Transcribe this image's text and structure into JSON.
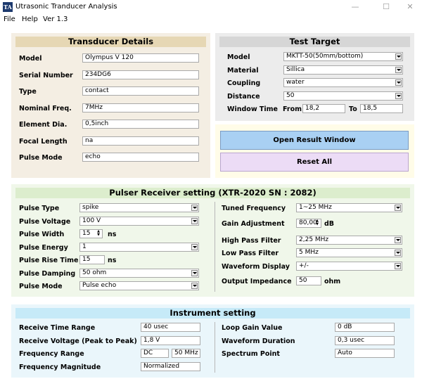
{
  "window": {
    "icon_text": "TA",
    "title": "Utrasonic Tranducer Analysis",
    "min": "—",
    "max": "☐",
    "close": "✕"
  },
  "menu": [
    "File",
    "Help",
    "Ver 1.3"
  ],
  "transducer": {
    "header": "Transducer Details",
    "rows": [
      {
        "label": "Model",
        "value": "Olympus V 120"
      },
      {
        "label": "Serial Number",
        "value": "234DG6"
      },
      {
        "label": "Type",
        "value": "contact"
      },
      {
        "label": "Nominal Freq.",
        "value": "7MHz"
      },
      {
        "label": "Element Dia.",
        "value": "0,5inch"
      },
      {
        "label": "Focal Length",
        "value": "na"
      },
      {
        "label": "Pulse Mode",
        "value": "echo"
      }
    ]
  },
  "target": {
    "header": "Test Target",
    "rows": [
      {
        "label": "Model",
        "value": "MKTT-50(50mm/bottom)"
      },
      {
        "label": "Material",
        "value": "Sillica"
      },
      {
        "label": "Coupling",
        "value": "water"
      },
      {
        "label": "Distance",
        "value": "50"
      }
    ],
    "window_time": {
      "label": "Window Time",
      "from_label": "From",
      "from": "18,2",
      "to_label": "To",
      "to": "18,5"
    }
  },
  "actions": {
    "open_result": "Open Result Window",
    "reset_all": "Reset All"
  },
  "pulser": {
    "header": "Pulser Receiver setting (XTR-2020  SN : 2082)",
    "left": [
      {
        "label": "Pulse Type",
        "value": "spike"
      },
      {
        "label": "Pulse Voltage",
        "value": "100 V"
      },
      {
        "label": "Pulse Width",
        "value": "15",
        "unit": "ns"
      },
      {
        "label": "Pulse Energy",
        "value": "1"
      },
      {
        "label": "Pulse Rise Time",
        "value": "15",
        "unit": "ns"
      },
      {
        "label": "Pulse Damping",
        "value": "50 ohm"
      },
      {
        "label": "Pulse Mode",
        "value": "Pulse echo"
      }
    ],
    "right": [
      {
        "label": "Tuned Frequency",
        "value": "1~25 MHz"
      },
      {
        "label": "Gain Adjustment",
        "value": "80,00",
        "unit": "dB"
      },
      {
        "label": "High Pass Filter",
        "value": "2,25 MHz"
      },
      {
        "label": "Low Pass Filter",
        "value": "5 MHz"
      },
      {
        "label": "Waveform Display",
        "value": "+/-"
      },
      {
        "label": "Output Impedance",
        "value": "50",
        "unit": "ohm"
      }
    ]
  },
  "instrument": {
    "header": "Instrument setting",
    "left": [
      {
        "label": "Receive Time Range",
        "value": "40 usec"
      },
      {
        "label": "Receive Voltage (Peak to Peak)",
        "value": "1,8 V"
      },
      {
        "label": "Frequency Range",
        "value": "DC",
        "value2": "50 MHz"
      },
      {
        "label": "Frequency Magnitude",
        "value": "Normalized"
      }
    ],
    "right": [
      {
        "label": "Loop Gain Value",
        "value": "0 dB"
      },
      {
        "label": "Waveform Duration",
        "value": "0,3 usec"
      },
      {
        "label": "Spectrum Point",
        "value": "Auto"
      }
    ]
  },
  "colors": {
    "transducer_bg": "#f4eee3",
    "transducer_header": "#e6d7b4",
    "target_bg": "#ececec",
    "target_header": "#d6d6d6",
    "actions_bg": "#fffce8",
    "open_btn": "#a9d0f3",
    "reset_btn": "#ecdcf6",
    "pulser_bg": "#f0f7ea",
    "pulser_header": "#dcedcd",
    "instrument_bg": "#eaf6fb",
    "instrument_header": "#c6eaf8"
  }
}
